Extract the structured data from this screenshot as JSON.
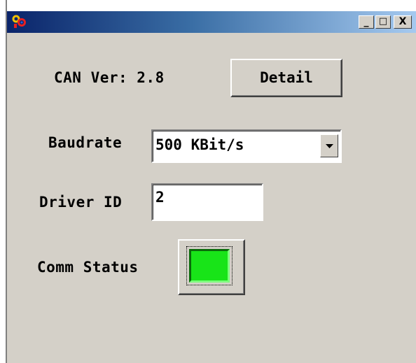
{
  "window": {
    "title": "",
    "icon": "app-gear-icon",
    "controls": {
      "minimize": "_",
      "maximize": "□",
      "close": "X"
    }
  },
  "can": {
    "label": "CAN Ver: 2.8",
    "detail_button": "Detail"
  },
  "baudrate": {
    "label": "Baudrate",
    "selected": "500 KBit/s"
  },
  "driver": {
    "label": "Driver ID",
    "value": "2"
  },
  "comm": {
    "label": "Comm Status",
    "status_color": "#18e418"
  }
}
